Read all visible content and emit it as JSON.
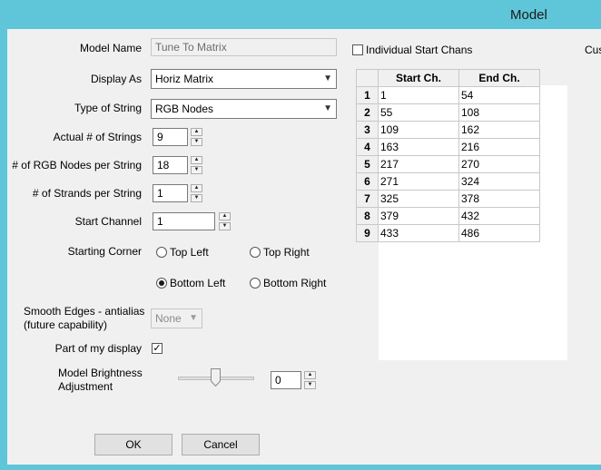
{
  "window": {
    "title": "Model"
  },
  "form": {
    "model_name_label": "Model Name",
    "model_name_value": "Tune To Matrix",
    "display_as_label": "Display As",
    "display_as_value": "Horiz Matrix",
    "type_of_string_label": "Type of String",
    "type_of_string_value": "RGB Nodes",
    "actual_strings_label": "Actual # of Strings",
    "actual_strings_value": "9",
    "rgb_nodes_label": "# of RGB Nodes per String",
    "rgb_nodes_value": "18",
    "strands_label": "# of Strands per String",
    "strands_value": "1",
    "start_channel_label": "Start Channel",
    "start_channel_value": "1",
    "starting_corner_label": "Starting Corner",
    "corner_top_left": "Top Left",
    "corner_top_right": "Top Right",
    "corner_bottom_left": "Bottom Left",
    "corner_bottom_right": "Bottom Right",
    "corner_selected": "Bottom Left",
    "smooth_edges_label_1": "Smooth Edges - antialias",
    "smooth_edges_label_2": "(future capability)",
    "smooth_edges_value": "None",
    "part_of_display_label": "Part of my display",
    "part_of_display_checked": true,
    "brightness_label_1": "Model Brightness",
    "brightness_label_2": "Adjustment",
    "brightness_value": "0",
    "brightness_slider_fraction": 0.5,
    "individual_start_label": "Individual Start Chans",
    "individual_start_checked": false,
    "custom_clipped": "Cus"
  },
  "grid": {
    "headers": [
      "Start Ch.",
      "End Ch."
    ],
    "rows": [
      [
        "1",
        "1",
        "54"
      ],
      [
        "2",
        "55",
        "108"
      ],
      [
        "3",
        "109",
        "162"
      ],
      [
        "4",
        "163",
        "216"
      ],
      [
        "5",
        "217",
        "270"
      ],
      [
        "6",
        "271",
        "324"
      ],
      [
        "7",
        "325",
        "378"
      ],
      [
        "8",
        "379",
        "432"
      ],
      [
        "9",
        "433",
        "486"
      ]
    ]
  },
  "buttons": {
    "ok": "OK",
    "cancel": "Cancel"
  }
}
